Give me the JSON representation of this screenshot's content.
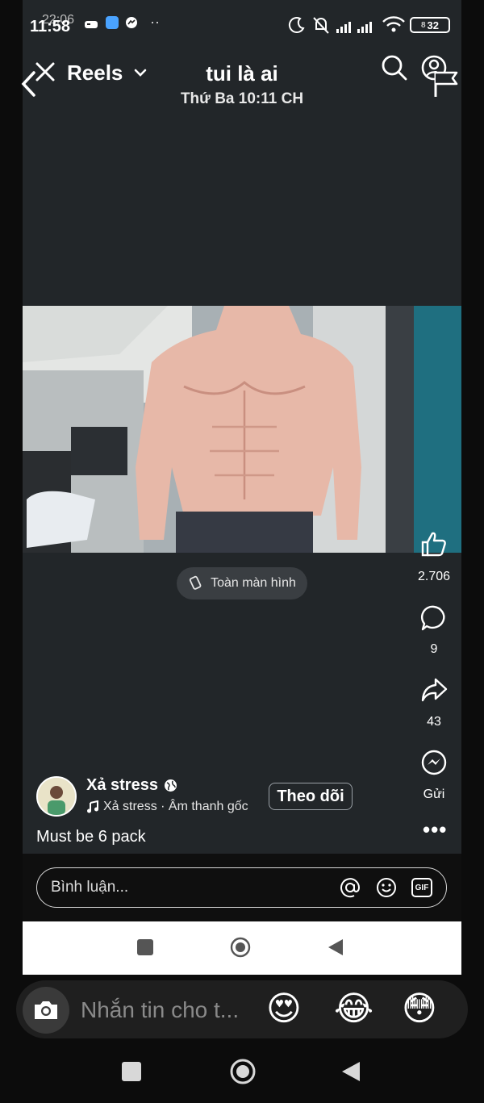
{
  "status_bar": {
    "time_front": "11:58",
    "time_back": "22:06",
    "battery_back": "32",
    "battery_front": "8"
  },
  "header": {
    "reels_label": "Reels",
    "chat_name": "tui là ai",
    "chat_timestamp": "Thứ Ba 10:11 CH"
  },
  "video": {
    "fullscreen_label": "Toàn màn hình"
  },
  "actions": {
    "like_count": "2.706",
    "comment_count": "9",
    "share_count": "43",
    "send_label": "Gửi"
  },
  "post": {
    "username": "Xả stress",
    "audio": "Xả stress · Âm thanh gốc",
    "follow_label": "Theo dõi",
    "caption": "Must be 6 pack"
  },
  "comment": {
    "placeholder": "Bình luận...",
    "gif_label": "GIF"
  },
  "messenger": {
    "placeholder": "Nhắn tin cho t...",
    "emojis": [
      "😍",
      "😂",
      "😳"
    ]
  },
  "colors": {
    "background": "#0c0c0c",
    "panel": "#222629",
    "nav_inner": "#ffffff"
  }
}
